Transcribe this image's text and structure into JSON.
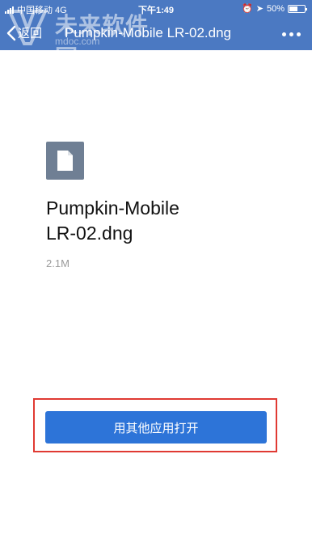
{
  "status_bar": {
    "carrier": "中国移动 4G",
    "time": "下午1:49",
    "battery": "50%"
  },
  "nav": {
    "back_label": "返回",
    "title": "Pumpkin-Mobile LR-02.dng"
  },
  "watermark": {
    "text": "未来软件园",
    "url": "mdoc.com"
  },
  "file": {
    "icon": "document-icon",
    "name_line1": "Pumpkin-Mobile",
    "name_line2": "LR-02.dng",
    "size": "2.1M"
  },
  "actions": {
    "open_with_other_app": "用其他应用打开"
  },
  "colors": {
    "header": "#4b79c2",
    "button": "#2d74d8",
    "highlight": "#e03a33",
    "file_icon_bg": "#6f7f94"
  }
}
